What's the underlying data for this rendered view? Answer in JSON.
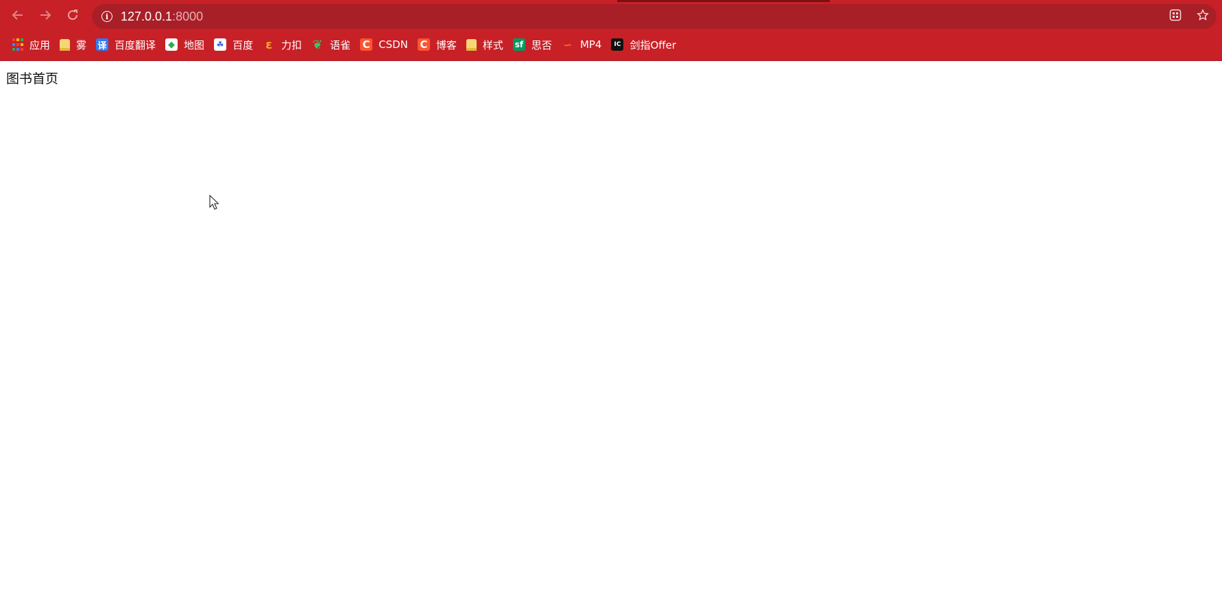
{
  "browser": {
    "url_host": "127.0.0.1",
    "url_port": ":8000",
    "nav": {
      "back_icon": "arrow-left-icon",
      "forward_icon": "arrow-right-icon",
      "reload_icon": "reload-icon"
    }
  },
  "bookmarks": [
    {
      "label": "应用",
      "icon": "apps-grid-icon"
    },
    {
      "label": "雾",
      "icon": "folder-icon"
    },
    {
      "label": "百度翻译",
      "icon": "baidu-fanyi-icon",
      "glyph": "译"
    },
    {
      "label": "地图",
      "icon": "maps-icon",
      "glyph": "◆"
    },
    {
      "label": "百度",
      "icon": "baidu-paw-icon",
      "glyph": "☘"
    },
    {
      "label": "力扣",
      "icon": "leetcode-icon",
      "glyph": "ε"
    },
    {
      "label": "语雀",
      "icon": "yuque-icon",
      "glyph": "❦"
    },
    {
      "label": "CSDN",
      "icon": "csdn-icon",
      "glyph": "C"
    },
    {
      "label": "博客",
      "icon": "blog-c-icon",
      "glyph": "C"
    },
    {
      "label": "样式",
      "icon": "folder-icon"
    },
    {
      "label": "思否",
      "icon": "segmentfault-icon",
      "glyph": "sf"
    },
    {
      "label": "MP4",
      "icon": "mp4-icon",
      "glyph": "∽"
    },
    {
      "label": "剑指Offer",
      "icon": "offer-icon",
      "glyph": "IC"
    }
  ],
  "page": {
    "heading": "图书首页"
  },
  "colors": {
    "toolbar_bg": "#c82027",
    "omnibox_bg": "#a91f27",
    "page_bg": "#ffffff"
  }
}
